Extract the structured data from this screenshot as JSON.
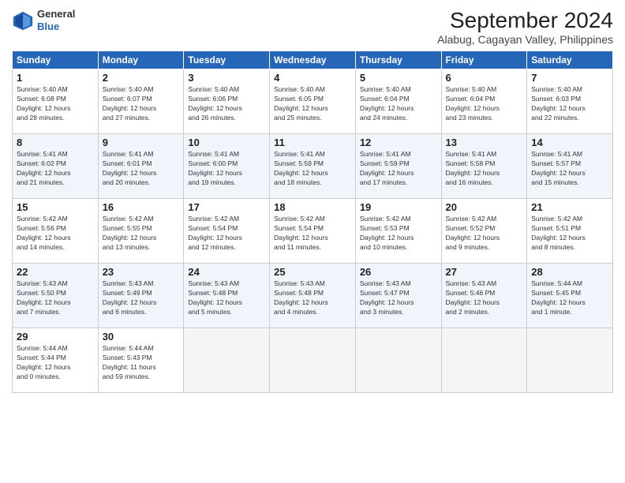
{
  "header": {
    "logo_line1": "General",
    "logo_line2": "Blue",
    "month": "September 2024",
    "location": "Alabug, Cagayan Valley, Philippines"
  },
  "columns": [
    "Sunday",
    "Monday",
    "Tuesday",
    "Wednesday",
    "Thursday",
    "Friday",
    "Saturday"
  ],
  "weeks": [
    [
      {
        "day": "1",
        "info": "Sunrise: 5:40 AM\nSunset: 6:08 PM\nDaylight: 12 hours\nand 28 minutes."
      },
      {
        "day": "2",
        "info": "Sunrise: 5:40 AM\nSunset: 6:07 PM\nDaylight: 12 hours\nand 27 minutes."
      },
      {
        "day": "3",
        "info": "Sunrise: 5:40 AM\nSunset: 6:06 PM\nDaylight: 12 hours\nand 26 minutes."
      },
      {
        "day": "4",
        "info": "Sunrise: 5:40 AM\nSunset: 6:05 PM\nDaylight: 12 hours\nand 25 minutes."
      },
      {
        "day": "5",
        "info": "Sunrise: 5:40 AM\nSunset: 6:04 PM\nDaylight: 12 hours\nand 24 minutes."
      },
      {
        "day": "6",
        "info": "Sunrise: 5:40 AM\nSunset: 6:04 PM\nDaylight: 12 hours\nand 23 minutes."
      },
      {
        "day": "7",
        "info": "Sunrise: 5:40 AM\nSunset: 6:03 PM\nDaylight: 12 hours\nand 22 minutes."
      }
    ],
    [
      {
        "day": "8",
        "info": "Sunrise: 5:41 AM\nSunset: 6:02 PM\nDaylight: 12 hours\nand 21 minutes."
      },
      {
        "day": "9",
        "info": "Sunrise: 5:41 AM\nSunset: 6:01 PM\nDaylight: 12 hours\nand 20 minutes."
      },
      {
        "day": "10",
        "info": "Sunrise: 5:41 AM\nSunset: 6:00 PM\nDaylight: 12 hours\nand 19 minutes."
      },
      {
        "day": "11",
        "info": "Sunrise: 5:41 AM\nSunset: 5:59 PM\nDaylight: 12 hours\nand 18 minutes."
      },
      {
        "day": "12",
        "info": "Sunrise: 5:41 AM\nSunset: 5:59 PM\nDaylight: 12 hours\nand 17 minutes."
      },
      {
        "day": "13",
        "info": "Sunrise: 5:41 AM\nSunset: 5:58 PM\nDaylight: 12 hours\nand 16 minutes."
      },
      {
        "day": "14",
        "info": "Sunrise: 5:41 AM\nSunset: 5:57 PM\nDaylight: 12 hours\nand 15 minutes."
      }
    ],
    [
      {
        "day": "15",
        "info": "Sunrise: 5:42 AM\nSunset: 5:56 PM\nDaylight: 12 hours\nand 14 minutes."
      },
      {
        "day": "16",
        "info": "Sunrise: 5:42 AM\nSunset: 5:55 PM\nDaylight: 12 hours\nand 13 minutes."
      },
      {
        "day": "17",
        "info": "Sunrise: 5:42 AM\nSunset: 5:54 PM\nDaylight: 12 hours\nand 12 minutes."
      },
      {
        "day": "18",
        "info": "Sunrise: 5:42 AM\nSunset: 5:54 PM\nDaylight: 12 hours\nand 11 minutes."
      },
      {
        "day": "19",
        "info": "Sunrise: 5:42 AM\nSunset: 5:53 PM\nDaylight: 12 hours\nand 10 minutes."
      },
      {
        "day": "20",
        "info": "Sunrise: 5:42 AM\nSunset: 5:52 PM\nDaylight: 12 hours\nand 9 minutes."
      },
      {
        "day": "21",
        "info": "Sunrise: 5:42 AM\nSunset: 5:51 PM\nDaylight: 12 hours\nand 8 minutes."
      }
    ],
    [
      {
        "day": "22",
        "info": "Sunrise: 5:43 AM\nSunset: 5:50 PM\nDaylight: 12 hours\nand 7 minutes."
      },
      {
        "day": "23",
        "info": "Sunrise: 5:43 AM\nSunset: 5:49 PM\nDaylight: 12 hours\nand 6 minutes."
      },
      {
        "day": "24",
        "info": "Sunrise: 5:43 AM\nSunset: 5:48 PM\nDaylight: 12 hours\nand 5 minutes."
      },
      {
        "day": "25",
        "info": "Sunrise: 5:43 AM\nSunset: 5:48 PM\nDaylight: 12 hours\nand 4 minutes."
      },
      {
        "day": "26",
        "info": "Sunrise: 5:43 AM\nSunset: 5:47 PM\nDaylight: 12 hours\nand 3 minutes."
      },
      {
        "day": "27",
        "info": "Sunrise: 5:43 AM\nSunset: 5:46 PM\nDaylight: 12 hours\nand 2 minutes."
      },
      {
        "day": "28",
        "info": "Sunrise: 5:44 AM\nSunset: 5:45 PM\nDaylight: 12 hours\nand 1 minute."
      }
    ],
    [
      {
        "day": "29",
        "info": "Sunrise: 5:44 AM\nSunset: 5:44 PM\nDaylight: 12 hours\nand 0 minutes."
      },
      {
        "day": "30",
        "info": "Sunrise: 5:44 AM\nSunset: 5:43 PM\nDaylight: 11 hours\nand 59 minutes."
      },
      {
        "day": "",
        "info": ""
      },
      {
        "day": "",
        "info": ""
      },
      {
        "day": "",
        "info": ""
      },
      {
        "day": "",
        "info": ""
      },
      {
        "day": "",
        "info": ""
      }
    ]
  ]
}
